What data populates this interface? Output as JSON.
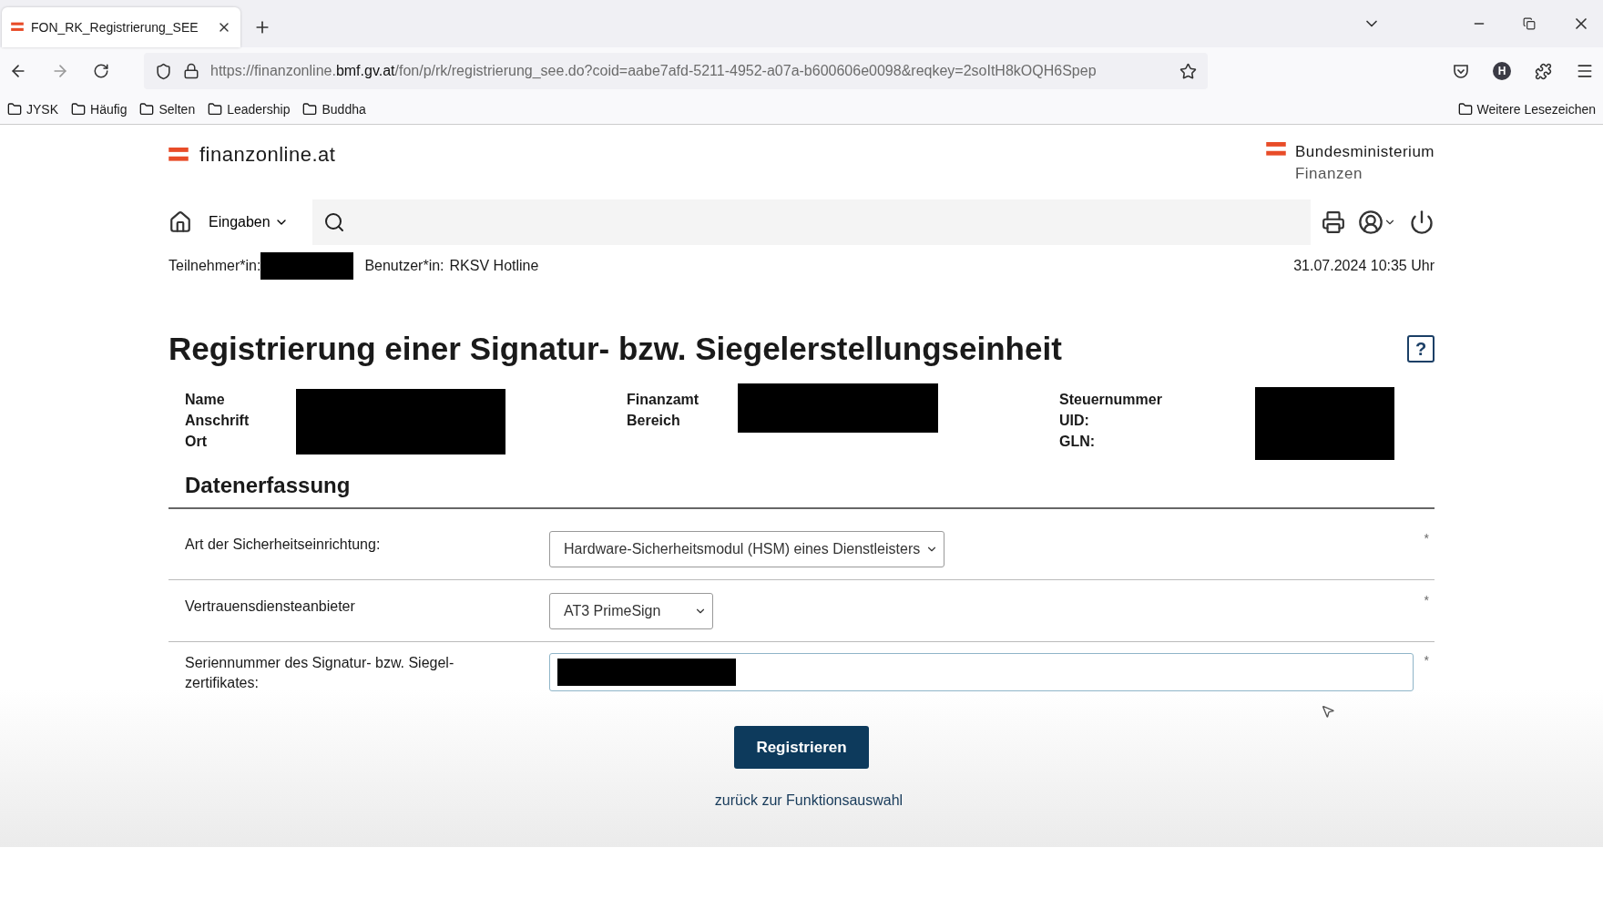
{
  "browser": {
    "tab_title": "FON_RK_Registrierung_SEE",
    "url_start": "https://finanzonline.",
    "url_domain": "bmf.gv.at",
    "url_rest": "/fon/p/rk/registrierung_see.do?coid=aabe7afd-5211-4952-a07a-b600606e0098&reqkey=2soItH8kOQH6Spep",
    "profile_initial": "H",
    "bookmarks": [
      "JYSK",
      "Häufig",
      "Selten",
      "Leadership",
      "Buddha"
    ],
    "more_bookmarks": "Weitere Lesezeichen"
  },
  "header": {
    "logo_text": "finanzonline.at",
    "ministry_line_1": "Bundesministerium",
    "ministry_line_2": "Finanzen"
  },
  "nav": {
    "menu": "Eingaben"
  },
  "session": {
    "participant_label": "Teilnehmer*in:",
    "user_label": "Benutzer*in:",
    "user_value": "RKSV Hotline",
    "datetime": "31.07.2024 10:35 Uhr"
  },
  "title": "Registrierung einer Signatur- bzw. Siegelerstellungseinheit",
  "help": "?",
  "info_columns": [
    {
      "labels": [
        "Name",
        "Anschrift",
        "Ort"
      ]
    },
    {
      "labels": [
        "Finanzamt",
        "Bereich"
      ]
    },
    {
      "labels": [
        "Steuernummer",
        "UID:",
        "GLN:"
      ]
    }
  ],
  "section_title": "Datenerfassung",
  "fields": [
    {
      "kind": "select",
      "label": "Art der Sicherheitseinrichtung:",
      "value": "Hardware-Sicherheitsmodul (HSM) eines Dienstleisters",
      "required_mark": "*"
    },
    {
      "kind": "select",
      "label": "Vertrauensdiensteanbieter",
      "value": "AT3 PrimeSign",
      "required_mark": "*"
    },
    {
      "kind": "input",
      "label": "Seriennummer des Signatur- bzw. Siegel-zertifikates:",
      "required_mark": "*"
    }
  ],
  "submit": "Registrieren",
  "back_link": "zurück zur Funktionsauswahl"
}
